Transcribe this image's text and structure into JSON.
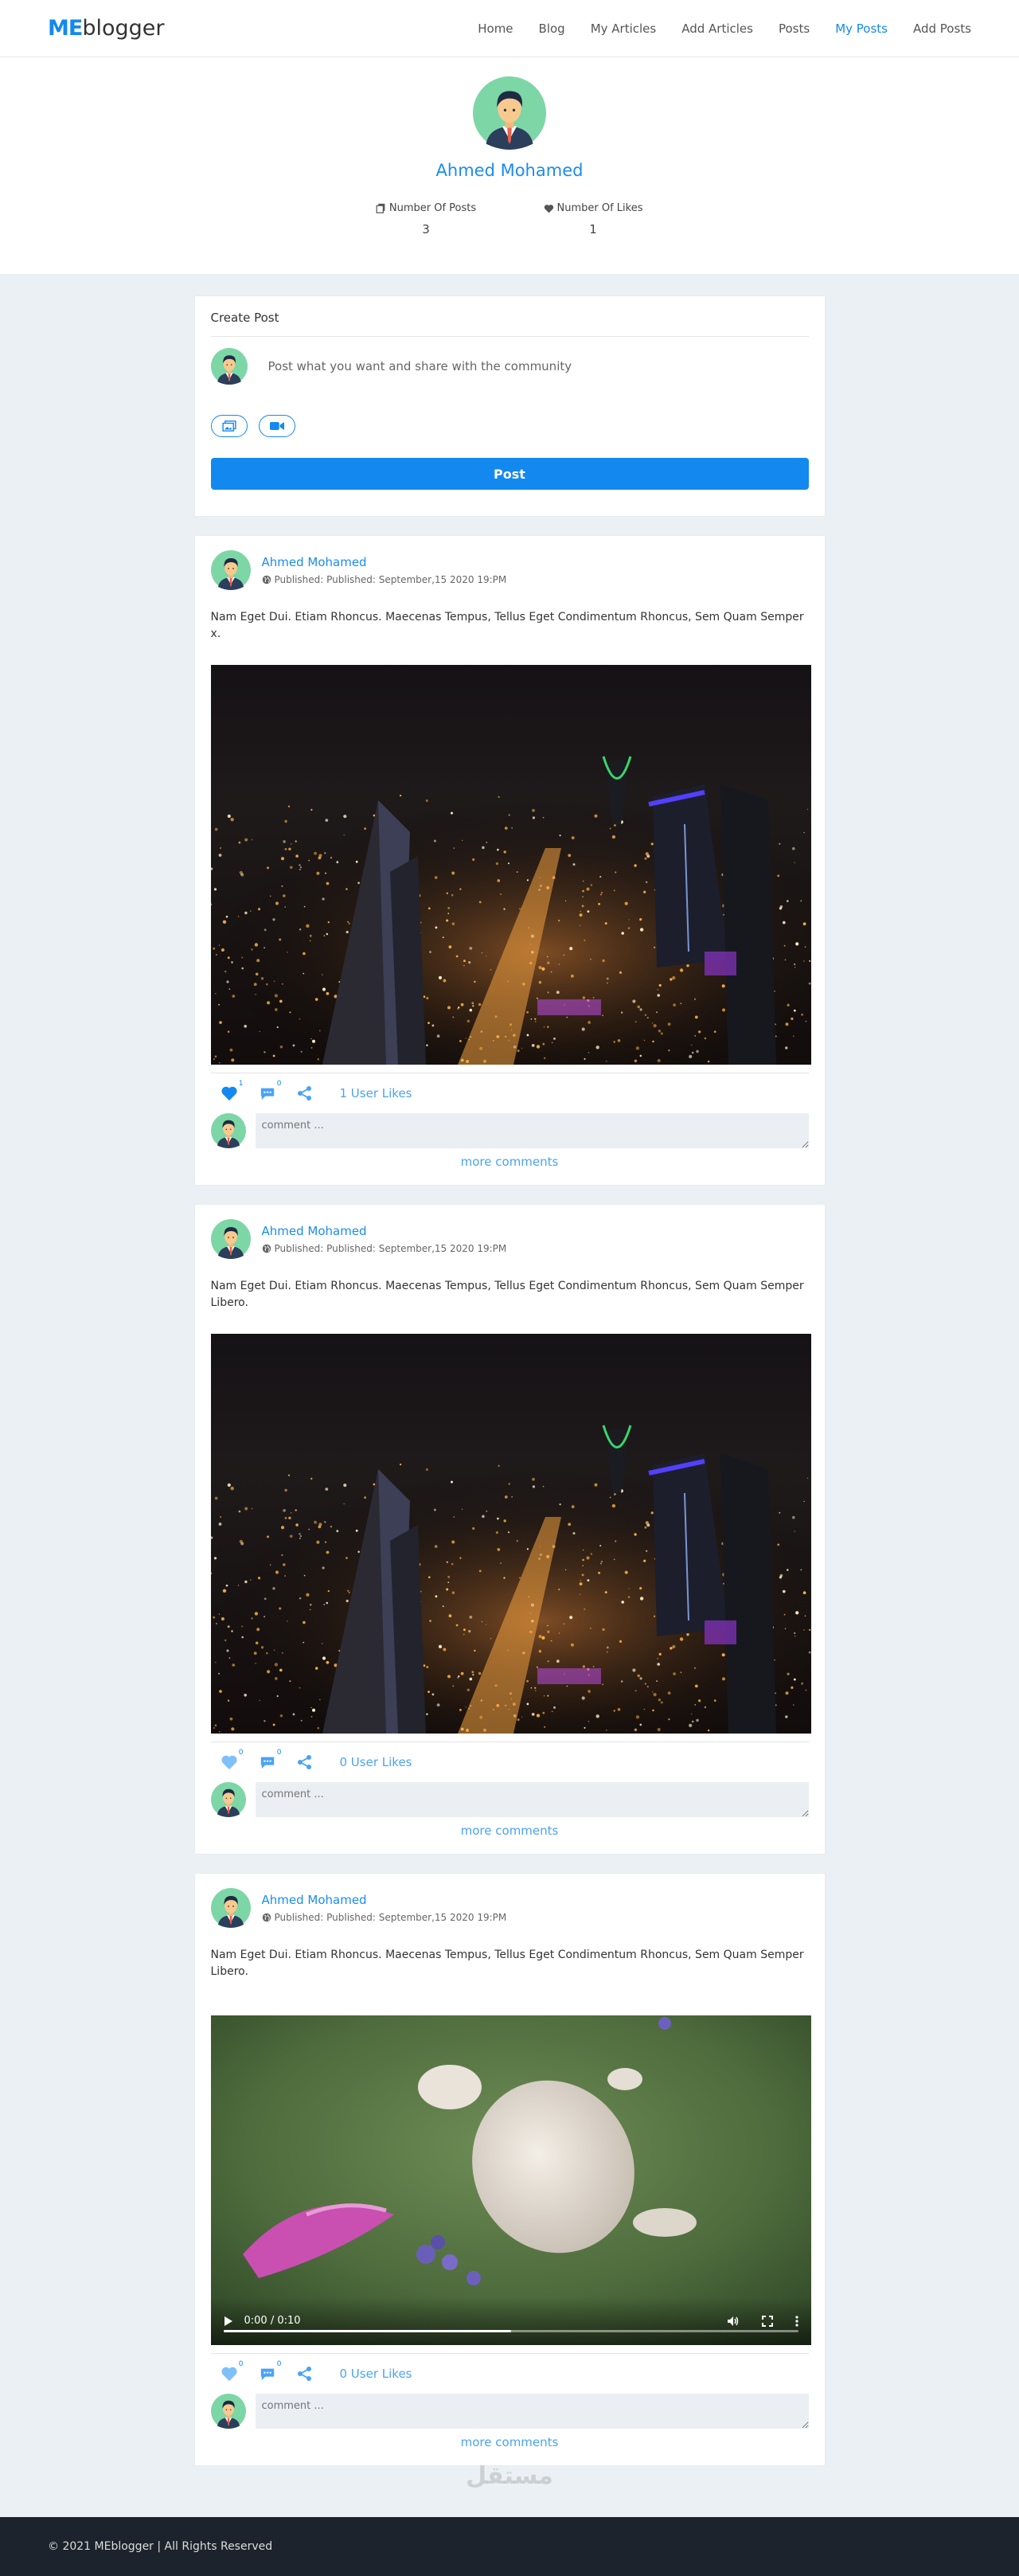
{
  "brand": {
    "logo_me": "ME",
    "logo_rest": "blogger"
  },
  "nav": [
    {
      "label": "Home",
      "active": false
    },
    {
      "label": "Blog",
      "active": false
    },
    {
      "label": "My Articles",
      "active": false
    },
    {
      "label": "Add Articles",
      "active": false
    },
    {
      "label": "Posts",
      "active": false
    },
    {
      "label": "My Posts",
      "active": true
    },
    {
      "label": "Add Posts",
      "active": false
    }
  ],
  "profile": {
    "name": "Ahmed Mohamed",
    "posts_label": "Number Of Posts",
    "posts_count": "3",
    "likes_label": "Number Of Likes",
    "likes_count": "1"
  },
  "create_post": {
    "title": "Create Post",
    "placeholder": "Post what you want and share with the community",
    "post_button": "Post",
    "media_buttons": [
      "image-icon",
      "video-camera-icon"
    ]
  },
  "posts": [
    {
      "author": "Ahmed Mohamed",
      "date": "Published: Published: September,15 2020 19:PM",
      "text": "Nam Eget Dui. Etiam Rhoncus. Maecenas Tempus, Tellus Eget Condimentum Rhoncus, Sem Quam Semper x.",
      "media": "image",
      "like_count": "1",
      "comment_count": "0",
      "likes_text": "1 User Likes",
      "liked": true,
      "comment_placeholder": "comment ...",
      "more_comments": "more comments"
    },
    {
      "author": "Ahmed Mohamed",
      "date": "Published: Published: September,15 2020 19:PM",
      "text": "Nam Eget Dui. Etiam Rhoncus. Maecenas Tempus, Tellus Eget Condimentum Rhoncus, Sem Quam Semper Libero.",
      "media": "image",
      "like_count": "0",
      "comment_count": "0",
      "likes_text": "0 User Likes",
      "liked": false,
      "comment_placeholder": "comment ...",
      "more_comments": "more comments"
    },
    {
      "author": "Ahmed Mohamed",
      "date": "Published: Published: September,15 2020 19:PM",
      "text": "Nam Eget Dui. Etiam Rhoncus. Maecenas Tempus, Tellus Eget Condimentum Rhoncus, Sem Quam Semper Libero.",
      "media": "video",
      "video_time": "0:00 / 0:10",
      "video_progress": 0.5,
      "like_count": "0",
      "comment_count": "0",
      "likes_text": "0 User Likes",
      "liked": false,
      "comment_placeholder": "comment ...",
      "more_comments": "more comments"
    }
  ],
  "footer": {
    "text": "© 2021 MEblogger | All Rights Reserved"
  },
  "watermark": {
    "text": "مستقل"
  },
  "colors": {
    "accent": "#1389f0",
    "footer_bg": "#1d232c",
    "page_bg": "#ebf0f5"
  }
}
